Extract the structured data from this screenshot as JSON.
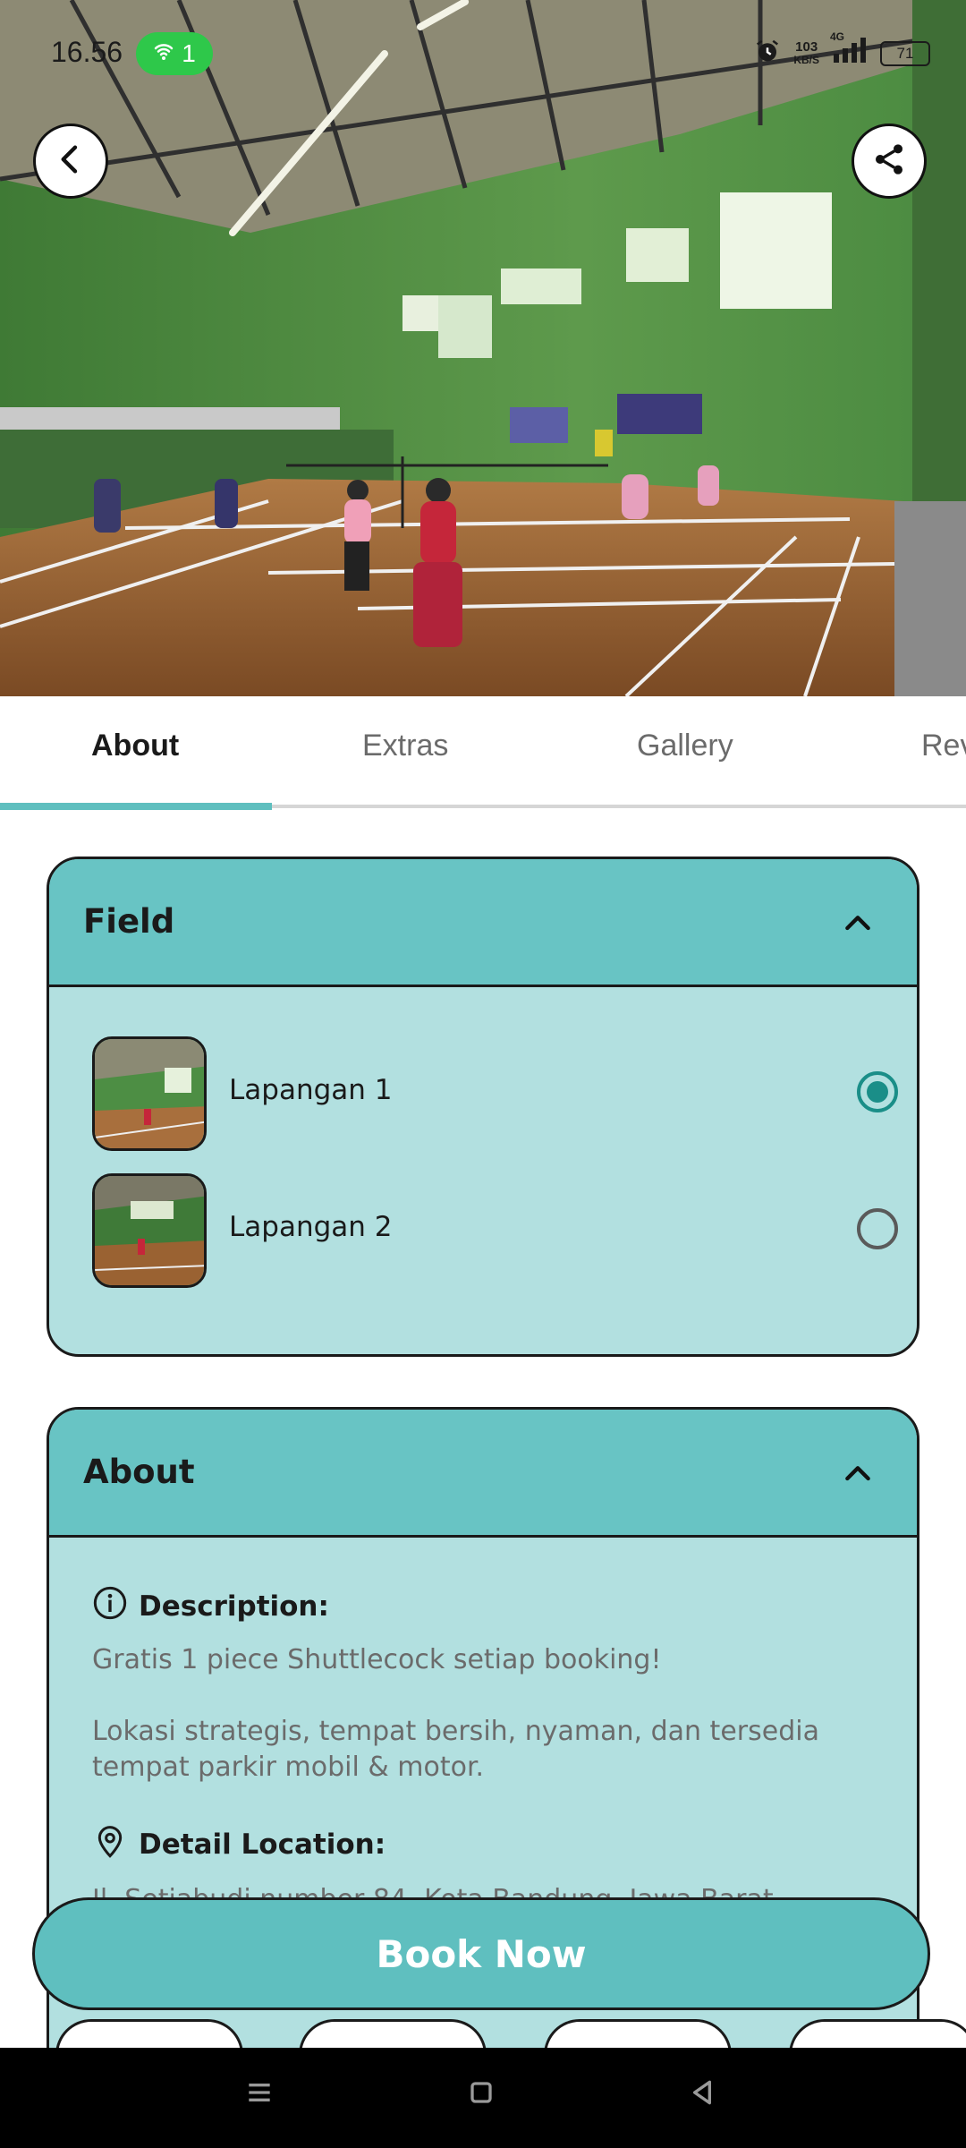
{
  "status_bar": {
    "time": "16.56",
    "hotspot_count": "1",
    "speed_value": "103",
    "speed_unit": "KB/S",
    "network": "4G",
    "battery": "71"
  },
  "tabs": [
    {
      "label": "About",
      "active": true
    },
    {
      "label": "Extras",
      "active": false
    },
    {
      "label": "Gallery",
      "active": false
    },
    {
      "label": "Rev",
      "active": false
    }
  ],
  "field_section": {
    "title": "Field",
    "items": [
      {
        "name": "Lapangan 1",
        "selected": true
      },
      {
        "name": "Lapangan 2",
        "selected": false
      }
    ]
  },
  "about_section": {
    "title": "About",
    "description_label": "Description:",
    "description_line1": "Gratis 1 piece Shuttlecock setiap booking!",
    "description_line2": "Lokasi strategis, tempat bersih, nyaman, dan tersedia tempat parkir mobil & motor.",
    "location_label": "Detail Location:",
    "location_text": "Jl. Setiabudi number 84, Kota Bandung, Jawa Barat"
  },
  "book_button": "Book Now",
  "colors": {
    "accent": "#5fbfbf",
    "card_bg": "#b2e0e0",
    "card_header": "#68c4c4",
    "radio_selected": "#1a8e88"
  },
  "icons": {
    "back": "chevron-left-icon",
    "share": "share-icon",
    "collapse": "chevron-up-icon",
    "description": "info-icon",
    "location": "location-pin-icon"
  }
}
